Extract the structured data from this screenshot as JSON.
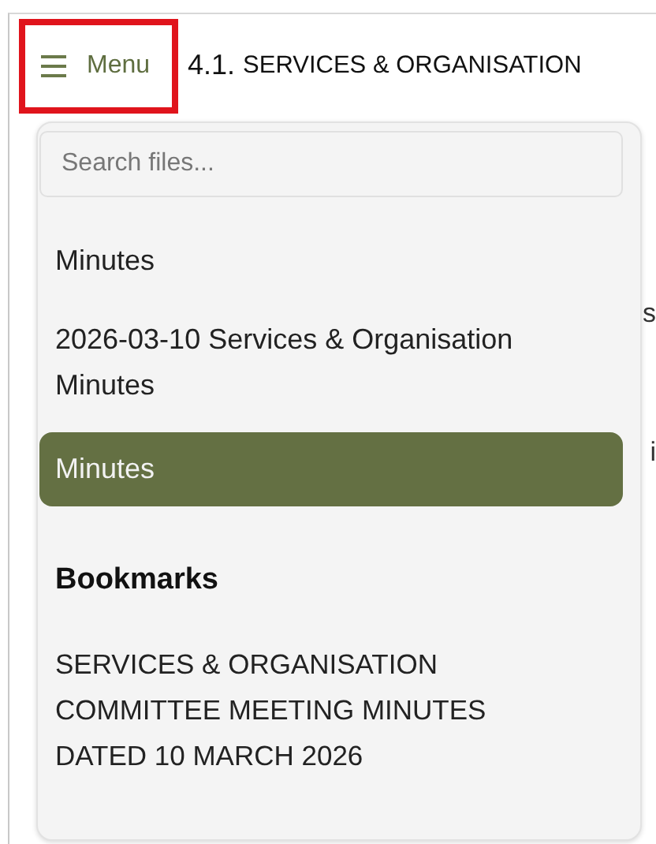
{
  "menu_button": {
    "label": "Menu",
    "highlighted": true
  },
  "heading": {
    "number": "4.1.",
    "title": "SERVICES & ORGANISATION"
  },
  "search": {
    "placeholder": "Search files..."
  },
  "files": [
    {
      "label": "Minutes",
      "selected": false
    },
    {
      "label": "2026-03-10 Services & Organisation Minutes",
      "selected": false
    },
    {
      "label": "Minutes",
      "selected": true
    }
  ],
  "bookmarks": {
    "title": "Bookmarks",
    "items": [
      "SERVICES & ORGANISATION COMMITTEE MEETING MINUTES DATED 10 MARCH 2026"
    ]
  },
  "background_fragments": [
    "s",
    "i"
  ]
}
